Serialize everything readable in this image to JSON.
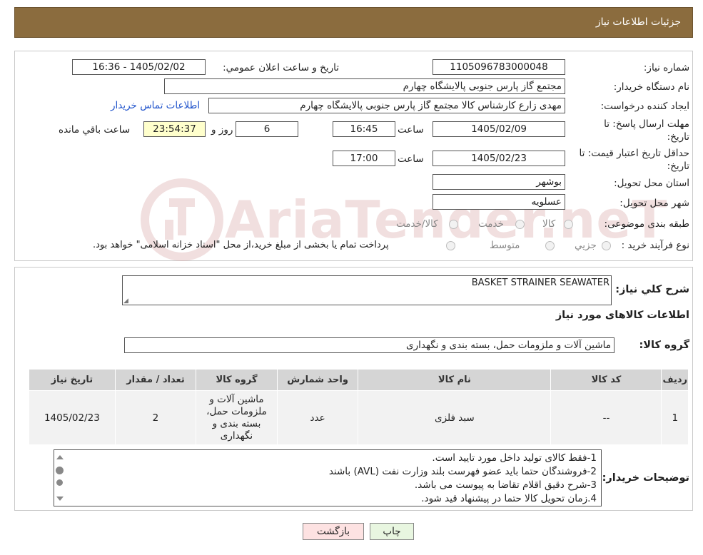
{
  "header": {
    "title": "جزئیات اطلاعات نیاز"
  },
  "form": {
    "need_number_label": "شماره نیاز:",
    "need_number": "1105096783000048",
    "announce_label": "تاریخ و ساعت اعلان عمومي:",
    "announce_value": "1405/02/02 - 16:36",
    "buyer_org_label": "نام دستگاه خريدار:",
    "buyer_org": "مجتمع گاز پارس جنوبی  پالایشگاه چهارم",
    "requester_label": "ايجاد کننده درخواست:",
    "requester": "مهدی زارع کارشناس کالا مجتمع گاز پارس جنوبی  پالایشگاه چهارم",
    "contact_link": "اطلاعات تماس خریدار",
    "deadline_label_1": "مهلت ارسال پاسخ: تا",
    "deadline_label_2": "تاريخ:",
    "deadline_date": "1405/02/09",
    "time_label": "ساعت",
    "deadline_time": "16:45",
    "days_value": "6",
    "days_label": "روز و",
    "remaining_time": "23:54:37",
    "remaining_label": "ساعت باقي مانده",
    "validity_label_1": "حداقل تاريخ اعتبار قيمت: تا",
    "validity_label_2": "تاريخ:",
    "validity_date": "1405/02/23",
    "validity_time_label": "ساعت",
    "validity_time": "17:00",
    "province_label": "استان محل تحويل:",
    "province": "بوشهر",
    "city_label": "شهر محل تحويل:",
    "city": "عسلويه",
    "category_label": "طبقه بندی موضوعی:",
    "category_options": [
      "کالا",
      "خدمت",
      "کالا/خدمت"
    ],
    "process_label": "نوع فرآيند خريد :",
    "process_options": [
      "جزيي",
      "متوسط"
    ],
    "process_note": "پرداخت تمام یا بخشی از مبلغ خرید،از محل \"اسناد خزانه اسلامی\" خواهد بود."
  },
  "watermark": {
    "text": "AriaTender.neT"
  },
  "details": {
    "summary_label": "شرح كلي نياز:",
    "summary": "BASKET STRAINER SEAWATER",
    "items_title": "اطلاعات کالاهای مورد نياز",
    "group_label": "گروه کالا:",
    "group_value": "ماشین آلات و ملزومات حمل، بسته بندی و نگهداری",
    "columns": [
      "رديف",
      "کد کالا",
      "نام کالا",
      "واحد شمارش",
      "گروه کالا",
      "تعداد / مقدار",
      "تاريخ نياز"
    ],
    "rows": [
      [
        "1",
        "--",
        "سبد فلزی",
        "عدد",
        "ماشین آلات و ملزومات حمل، بسته بندی و نگهداری",
        "2",
        "1405/02/23"
      ]
    ],
    "buyer_notes_label": "توضيحات خريدار:",
    "buyer_notes": [
      "1-فقط کالای تولید داخل مورد تایید است.",
      "2-فروشندگان حتما باید عضو فهرست بلند وزارت نفت (AVL) باشند",
      "3-شرح دقیق اقلام تقاضا به پیوست می باشد.",
      "4.زمان تحویل کالا حتما در پیشنهاد قید شود."
    ]
  },
  "buttons": {
    "back": "بازگشت",
    "print": "چاپ"
  },
  "colors": {
    "header": "#8b6c3e",
    "remaining_bg": "#ffffcc",
    "link": "#2255cc"
  }
}
